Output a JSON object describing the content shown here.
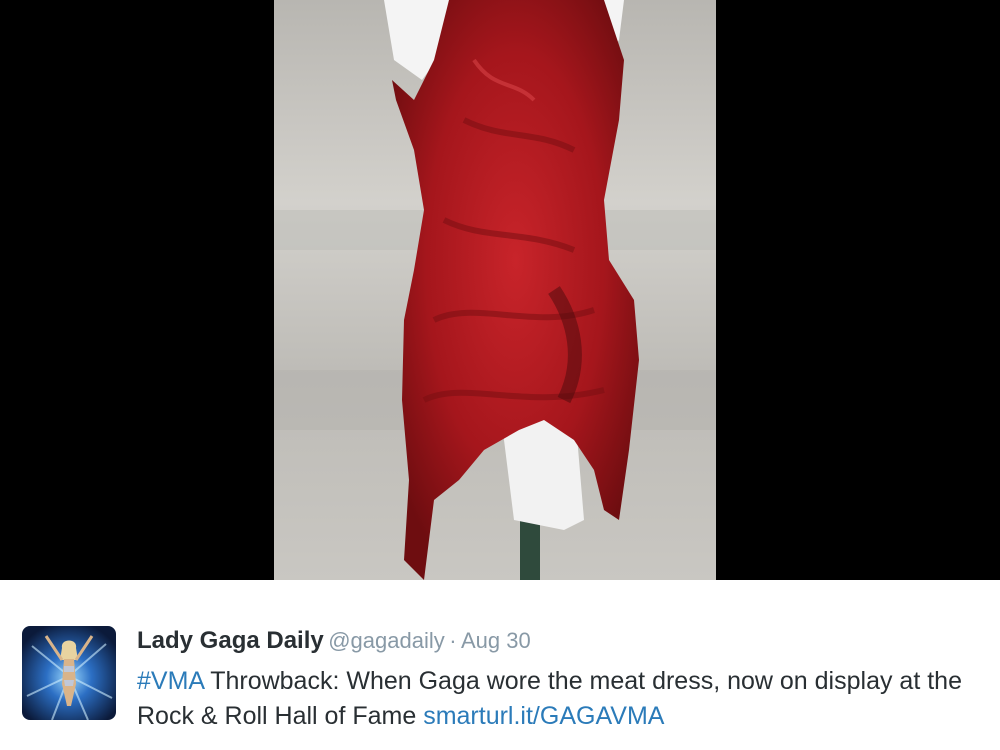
{
  "media": {
    "subject": "meat dress on mannequin",
    "colors": {
      "letterbox": "#000000",
      "dress": "#b01a1f",
      "background_wall": "#c8c6c1"
    }
  },
  "tweet": {
    "display_name": "Lady Gaga Daily",
    "handle": "@gagadaily",
    "separator": "·",
    "date": "Aug 30",
    "hashtag": "#VMA",
    "text_1": " Throwback: When Gaga wore the meat dress, now on display at the Rock & Roll Hall of Fame ",
    "link": "smarturl.it/GAGAVMA",
    "colors": {
      "name": "#292f33",
      "meta": "#8899a6",
      "link": "#2b7bb9"
    }
  }
}
